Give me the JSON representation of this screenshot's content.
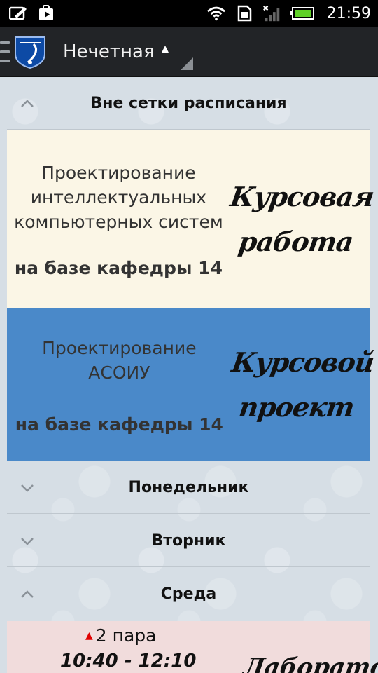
{
  "status_bar": {
    "icons_left": [
      "edit-image-icon",
      "play-store-icon"
    ],
    "icons_right": [
      "wifi-icon",
      "sim-icon",
      "signal-icon",
      "battery-icon"
    ],
    "time": "21:59"
  },
  "action_bar": {
    "title": "Нечетная",
    "caret": "▲",
    "logo": "university-logo-icon"
  },
  "sections": {
    "off_schedule": {
      "label": "Вне сетки расписания",
      "state": "expanded"
    },
    "monday": {
      "label": "Понедельник",
      "state": "collapsed"
    },
    "tuesday": {
      "label": "Вторник",
      "state": "collapsed"
    },
    "wednesday": {
      "label": "Среда",
      "state": "expanded"
    }
  },
  "cards": [
    {
      "subject_lines": [
        "Проектирование",
        "интеллектуальных",
        "компьютерных систем"
      ],
      "place": "на базе кафедры 14",
      "stamp_lines": [
        "Курсовая",
        "работа"
      ],
      "bg": "#fbf6e6"
    },
    {
      "subject_lines": [
        "Проектирование",
        "АСОИУ"
      ],
      "place": "на базе кафедры 14",
      "stamp_lines": [
        "Курсовой",
        "проект"
      ],
      "bg": "#4a89c9"
    }
  ],
  "wednesday_card": {
    "pair": "2 пара",
    "time": "10:40 - 12:10",
    "stamp": "Лабораторная",
    "bg": "#f1dcdc",
    "marker_color": "#e00000"
  }
}
